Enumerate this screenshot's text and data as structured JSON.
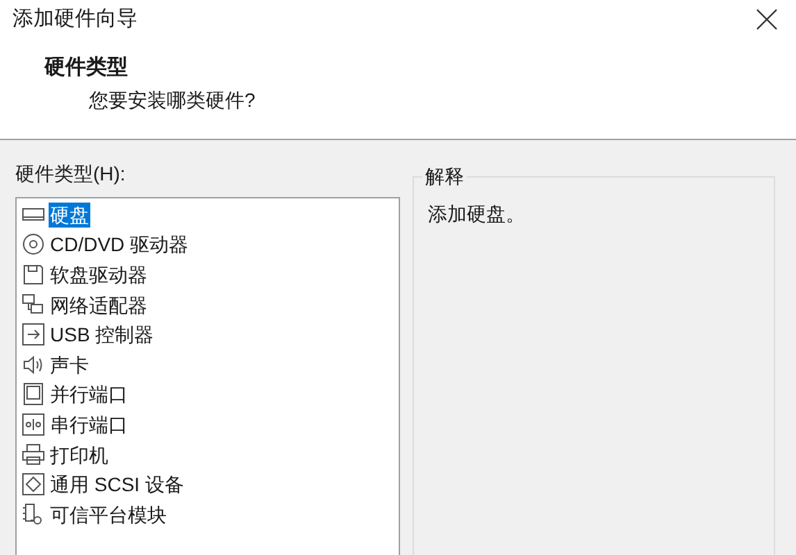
{
  "window": {
    "title": "添加硬件向导"
  },
  "header": {
    "title": "硬件类型",
    "subtitle": "您要安装哪类硬件?"
  },
  "hardware_list": {
    "label": "硬件类型(H):",
    "items": [
      {
        "label": "硬盘",
        "kind": "disk",
        "selected": true
      },
      {
        "label": "CD/DVD 驱动器",
        "kind": "cd",
        "selected": false
      },
      {
        "label": "软盘驱动器",
        "kind": "floppy",
        "selected": false
      },
      {
        "label": "网络适配器",
        "kind": "network",
        "selected": false
      },
      {
        "label": "USB 控制器",
        "kind": "usb",
        "selected": false
      },
      {
        "label": "声卡",
        "kind": "sound",
        "selected": false
      },
      {
        "label": "并行端口",
        "kind": "parallel",
        "selected": false
      },
      {
        "label": "串行端口",
        "kind": "serial",
        "selected": false
      },
      {
        "label": "打印机",
        "kind": "printer",
        "selected": false
      },
      {
        "label": "通用 SCSI 设备",
        "kind": "scsi",
        "selected": false
      },
      {
        "label": "可信平台模块",
        "kind": "tpm",
        "selected": false
      }
    ]
  },
  "explanation": {
    "title": "解释",
    "text": "添加硬盘。"
  }
}
